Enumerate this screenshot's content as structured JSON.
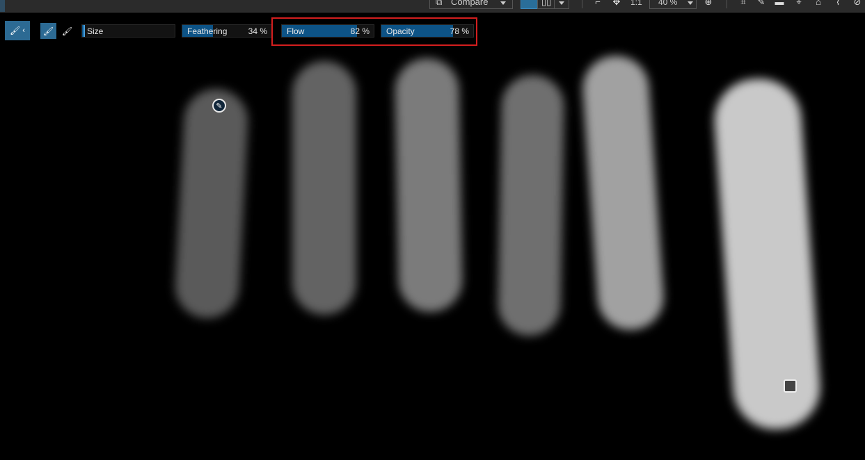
{
  "top_toolbar": {
    "compare_label": "Compare",
    "ratio_label": "1:1",
    "zoom_value": "40 %"
  },
  "tool_options": {
    "size": {
      "label": "Size",
      "value": "",
      "fill": 0.03
    },
    "feathering": {
      "label": "Feathering",
      "value": "34 %",
      "fill": 0.34
    },
    "flow": {
      "label": "Flow",
      "value": "82 %",
      "fill": 0.82
    },
    "opacity": {
      "label": "Opacity",
      "value": "78 %",
      "fill": 0.78
    }
  },
  "colors": {
    "accent": "#2c6a93",
    "slider_fill": "#0d5386",
    "highlight": "#d41e1e",
    "stroke_grays": [
      "#5a5a5a",
      "#636363",
      "#7b7b7b",
      "#6f6f6f",
      "#a1a1a1",
      "#c9c9c9"
    ]
  },
  "icons": {
    "brush_tool": "brush-icon",
    "brush_add": "brush-add-icon",
    "brush_erase": "brush-erase-icon",
    "cursor": "brush-cursor-icon",
    "pin": "mask-pin-icon"
  }
}
